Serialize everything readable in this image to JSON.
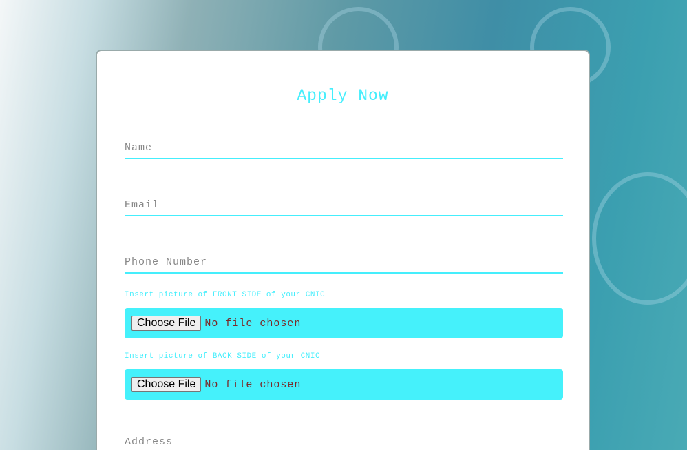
{
  "form": {
    "title": "Apply Now",
    "name_placeholder": "Name",
    "email_placeholder": "Email",
    "phone_placeholder": "Phone Number",
    "front_label": "Insert picture of FRONT SIDE of your CNIC",
    "back_label": "Insert picture of BACK SIDE of your CNIC",
    "choose_file": "Choose File",
    "no_file": "No file chosen",
    "address_placeholder": "Address"
  }
}
